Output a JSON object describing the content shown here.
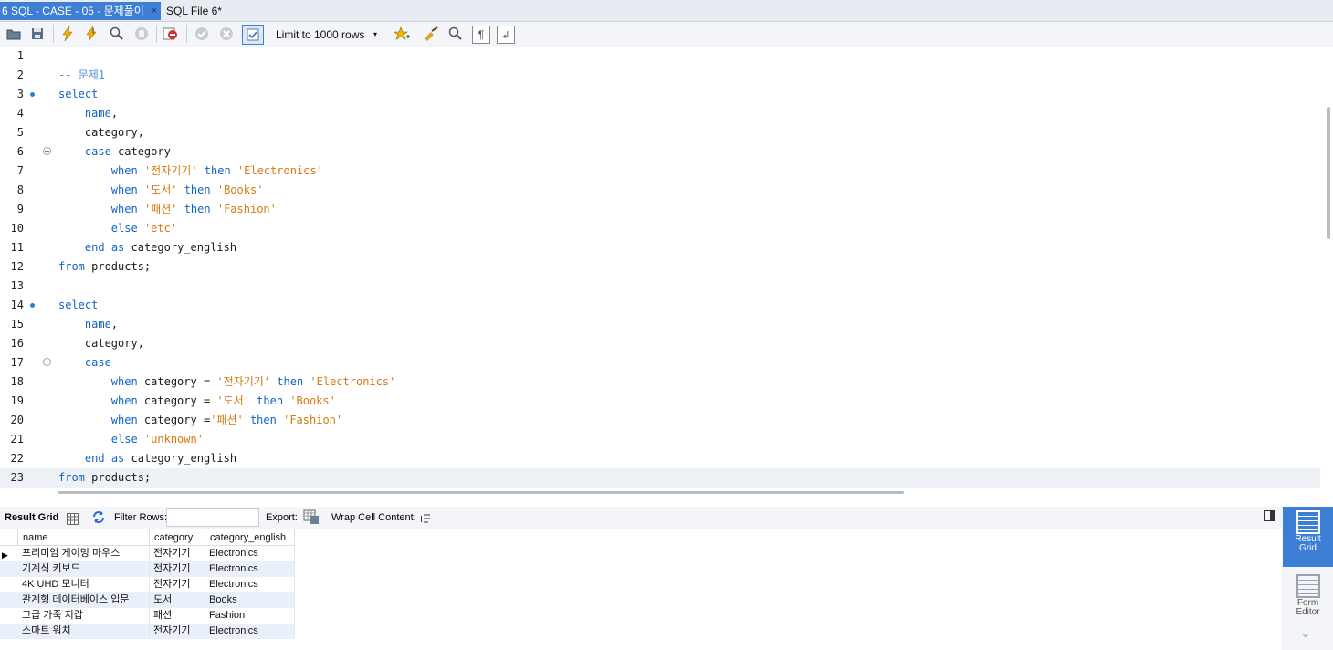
{
  "tabs": [
    {
      "label": "6 SQL - CASE - 05 - 문제풀이",
      "active": true,
      "close": "×"
    },
    {
      "label": "SQL File 6*",
      "active": false
    }
  ],
  "toolbar": {
    "limit_select": "Limit to 1000 rows",
    "limit_arrow": "▾"
  },
  "editor": {
    "lines": [
      {
        "n": "1",
        "code": []
      },
      {
        "n": "2",
        "code": [
          {
            "t": "cm",
            "v": "-- 문제1"
          }
        ]
      },
      {
        "n": "3",
        "marker": true,
        "code": [
          {
            "t": "kw",
            "v": "select"
          }
        ]
      },
      {
        "n": "4",
        "code": [
          {
            "t": "tx",
            "v": "    "
          },
          {
            "t": "kw",
            "v": "name"
          },
          {
            "t": "tx",
            "v": ","
          }
        ]
      },
      {
        "n": "5",
        "code": [
          {
            "t": "tx",
            "v": "    category,"
          }
        ]
      },
      {
        "n": "6",
        "fold": true,
        "code": [
          {
            "t": "tx",
            "v": "    "
          },
          {
            "t": "kw",
            "v": "case"
          },
          {
            "t": "tx",
            "v": " category"
          }
        ]
      },
      {
        "n": "7",
        "code": [
          {
            "t": "tx",
            "v": "        "
          },
          {
            "t": "kw",
            "v": "when"
          },
          {
            "t": "tx",
            "v": " "
          },
          {
            "t": "str",
            "v": "'전자기기'"
          },
          {
            "t": "tx",
            "v": " "
          },
          {
            "t": "kw",
            "v": "then"
          },
          {
            "t": "tx",
            "v": " "
          },
          {
            "t": "str",
            "v": "'Electronics'"
          }
        ]
      },
      {
        "n": "8",
        "code": [
          {
            "t": "tx",
            "v": "        "
          },
          {
            "t": "kw",
            "v": "when"
          },
          {
            "t": "tx",
            "v": " "
          },
          {
            "t": "str",
            "v": "'도서'"
          },
          {
            "t": "tx",
            "v": " "
          },
          {
            "t": "kw",
            "v": "then"
          },
          {
            "t": "tx",
            "v": " "
          },
          {
            "t": "str",
            "v": "'Books'"
          }
        ]
      },
      {
        "n": "9",
        "code": [
          {
            "t": "tx",
            "v": "        "
          },
          {
            "t": "kw",
            "v": "when"
          },
          {
            "t": "tx",
            "v": " "
          },
          {
            "t": "str",
            "v": "'패션'"
          },
          {
            "t": "tx",
            "v": " "
          },
          {
            "t": "kw",
            "v": "then"
          },
          {
            "t": "tx",
            "v": " "
          },
          {
            "t": "str",
            "v": "'Fashion'"
          }
        ]
      },
      {
        "n": "10",
        "code": [
          {
            "t": "tx",
            "v": "        "
          },
          {
            "t": "kw",
            "v": "else"
          },
          {
            "t": "tx",
            "v": " "
          },
          {
            "t": "str",
            "v": "'etc'"
          }
        ]
      },
      {
        "n": "11",
        "code": [
          {
            "t": "tx",
            "v": "    "
          },
          {
            "t": "kw",
            "v": "end"
          },
          {
            "t": "tx",
            "v": " "
          },
          {
            "t": "kw",
            "v": "as"
          },
          {
            "t": "tx",
            "v": " category_english"
          }
        ]
      },
      {
        "n": "12",
        "code": [
          {
            "t": "kw",
            "v": "from"
          },
          {
            "t": "tx",
            "v": " products;"
          }
        ]
      },
      {
        "n": "13",
        "code": []
      },
      {
        "n": "14",
        "marker": true,
        "code": [
          {
            "t": "kw",
            "v": "select"
          }
        ]
      },
      {
        "n": "15",
        "code": [
          {
            "t": "tx",
            "v": "    "
          },
          {
            "t": "kw",
            "v": "name"
          },
          {
            "t": "tx",
            "v": ","
          }
        ]
      },
      {
        "n": "16",
        "code": [
          {
            "t": "tx",
            "v": "    category,"
          }
        ]
      },
      {
        "n": "17",
        "fold": true,
        "code": [
          {
            "t": "tx",
            "v": "    "
          },
          {
            "t": "kw",
            "v": "case"
          }
        ]
      },
      {
        "n": "18",
        "code": [
          {
            "t": "tx",
            "v": "        "
          },
          {
            "t": "kw",
            "v": "when"
          },
          {
            "t": "tx",
            "v": " category = "
          },
          {
            "t": "str",
            "v": "'전자기기'"
          },
          {
            "t": "tx",
            "v": " "
          },
          {
            "t": "kw",
            "v": "then"
          },
          {
            "t": "tx",
            "v": " "
          },
          {
            "t": "str",
            "v": "'Electronics'"
          }
        ]
      },
      {
        "n": "19",
        "code": [
          {
            "t": "tx",
            "v": "        "
          },
          {
            "t": "kw",
            "v": "when"
          },
          {
            "t": "tx",
            "v": " category = "
          },
          {
            "t": "str",
            "v": "'도서'"
          },
          {
            "t": "tx",
            "v": " "
          },
          {
            "t": "kw",
            "v": "then"
          },
          {
            "t": "tx",
            "v": " "
          },
          {
            "t": "str",
            "v": "'Books'"
          }
        ]
      },
      {
        "n": "20",
        "code": [
          {
            "t": "tx",
            "v": "        "
          },
          {
            "t": "kw",
            "v": "when"
          },
          {
            "t": "tx",
            "v": " category ="
          },
          {
            "t": "str",
            "v": "'패션'"
          },
          {
            "t": "tx",
            "v": " "
          },
          {
            "t": "kw",
            "v": "then"
          },
          {
            "t": "tx",
            "v": " "
          },
          {
            "t": "str",
            "v": "'Fashion'"
          }
        ]
      },
      {
        "n": "21",
        "code": [
          {
            "t": "tx",
            "v": "        "
          },
          {
            "t": "kw",
            "v": "else"
          },
          {
            "t": "tx",
            "v": " "
          },
          {
            "t": "str",
            "v": "'unknown'"
          }
        ]
      },
      {
        "n": "22",
        "code": [
          {
            "t": "tx",
            "v": "    "
          },
          {
            "t": "kw",
            "v": "end"
          },
          {
            "t": "tx",
            "v": " "
          },
          {
            "t": "kw",
            "v": "as"
          },
          {
            "t": "tx",
            "v": " category_english"
          }
        ]
      },
      {
        "n": "23",
        "current": true,
        "code": [
          {
            "t": "kw",
            "v": "from"
          },
          {
            "t": "tx",
            "v": " products;"
          }
        ]
      }
    ]
  },
  "result_toolbar": {
    "result_grid": "Result Grid",
    "filter_rows": "Filter Rows:",
    "export": "Export:",
    "wrap": "Wrap Cell Content:"
  },
  "grid": {
    "columns": [
      "name",
      "category",
      "category_english"
    ],
    "rows": [
      [
        "프리미엄 게이밍 마우스",
        "전자기기",
        "Electronics"
      ],
      [
        "기계식 키보드",
        "전자기기",
        "Electronics"
      ],
      [
        "4K UHD 모니터",
        "전자기기",
        "Electronics"
      ],
      [
        "관계형 데이터베이스 입문",
        "도서",
        "Books"
      ],
      [
        "고급 가죽 지갑",
        "패션",
        "Fashion"
      ],
      [
        "스마트 워치",
        "전자기기",
        "Electronics"
      ]
    ]
  },
  "side_panel": {
    "result_grid": [
      "Result",
      "Grid"
    ],
    "form_editor": [
      "Form",
      "Editor"
    ]
  },
  "colors": {
    "accent": "#3c7fd5",
    "keyword": "#0f63c6",
    "string": "#d7790f",
    "comment": "#4b8ed8"
  }
}
